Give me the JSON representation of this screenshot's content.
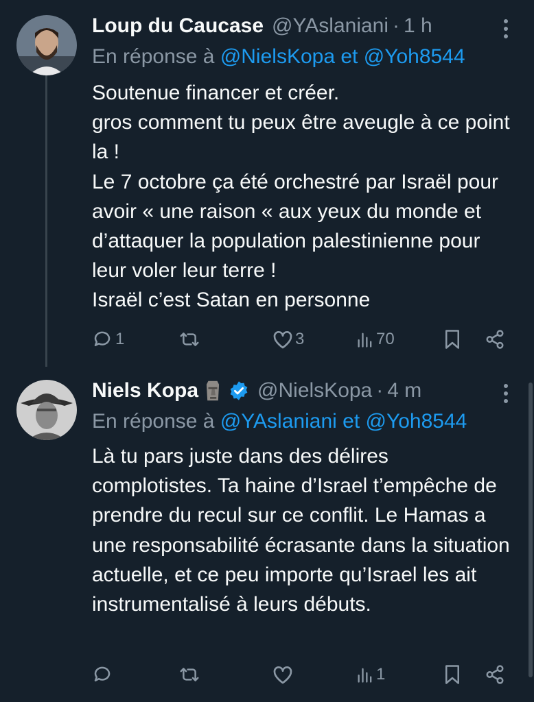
{
  "tweets": [
    {
      "name": "Loup du Caucase",
      "handle": "@YAslaniani",
      "separator": "·",
      "time": "1 h",
      "reply_prefix": "En réponse à",
      "reply_user1": "@NielsKopa",
      "reply_and": "et",
      "reply_user2": "@Yoh8544",
      "lines": [
        "Soutenue financer et créer.",
        "gros comment tu peux être aveugle à ce point la !",
        "Le 7 octobre ça été orchestré par Israël pour avoir « une raison «  aux yeux du monde et d’attaquer la population palestinienne pour leur voler leur terre !",
        "Israël c’est Satan en personne"
      ],
      "replies": "1",
      "retweets": "",
      "likes": "3",
      "views": "70",
      "icons": {
        "reply": "reply-icon",
        "retweet": "retweet-icon",
        "like": "heart-icon",
        "views": "views-icon",
        "bookmark": "bookmark-icon",
        "share": "share-icon"
      }
    },
    {
      "name": "Niels Kopa",
      "emoji": "moai",
      "verified_color": "#1d9bf0",
      "handle": "@NielsKopa",
      "separator": "·",
      "time": "4 m",
      "reply_prefix": "En réponse à",
      "reply_user1": "@YAslaniani",
      "reply_and": "et",
      "reply_user2": "@Yoh8544",
      "lines": [
        "Là tu pars juste dans des délires complotistes. Ta haine d’Israel t’empêche de prendre du recul sur ce conflit. Le Hamas a une responsabilité écrasante dans la situation actuelle, et ce peu importe qu’Israel les ait instrumentalisé à leurs débuts."
      ],
      "replies": "",
      "retweets": "",
      "likes": "",
      "views": "1"
    }
  ],
  "colors": {
    "background": "#15202b",
    "text": "#f7f9f9",
    "muted": "#8b98a5",
    "link": "#1d9bf0"
  }
}
